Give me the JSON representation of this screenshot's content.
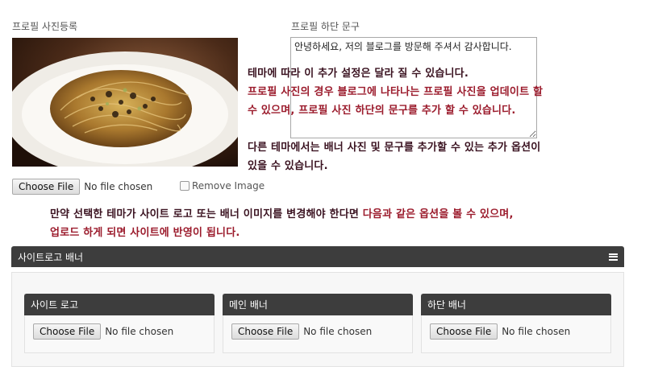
{
  "profile": {
    "photo_label": "프로필 사진등록",
    "footer_label": "프로필 하단 문구",
    "footer_text": "안녕하세요, 저의 블로그를 방문해 주셔서 감사합니다.",
    "choose_file": "Choose File",
    "no_file": "No file chosen",
    "remove_image": "Remove Image"
  },
  "annotations": {
    "a1_line1": "테마에 따라 이 추가 설정은 달라 질 수 있습니다.",
    "a1_line2": "프로필 사진의 경우 블로그에 나타나는 프로필 사진을 업데이트 할",
    "a1_line3": "수 있으며, 프로필 사진 하단의 문구를 추가 할 수 있습니다.",
    "a2_line1": "다른 테마에서는 배너 사진 및 문구를 추가할 수 있는 추가 옵션이",
    "a2_line2": "있을 수 있습니다.",
    "a3_line1_dark": "만약 선택한 테마가 사이트 로고 또는 배너 이미지를 변경해야 한다면 ",
    "a3_line1_red": "다음과 같은 옵션을 볼 수 있으며,",
    "a3_line2": "업로드 하게 되면 사이트에 반영이 됩니다."
  },
  "site_panel": {
    "title": "사이트로고 배너",
    "sections": [
      {
        "title": "사이트 로고",
        "choose_file": "Choose File",
        "no_file": "No file chosen"
      },
      {
        "title": "메인 배너",
        "choose_file": "Choose File",
        "no_file": "No file chosen"
      },
      {
        "title": "하단 배너",
        "choose_file": "Choose File",
        "no_file": "No file chosen"
      }
    ]
  },
  "colors": {
    "header_bg": "#3d3d3d",
    "annotation_dark": "#3a1220",
    "annotation_red": "#9b1b2c"
  }
}
